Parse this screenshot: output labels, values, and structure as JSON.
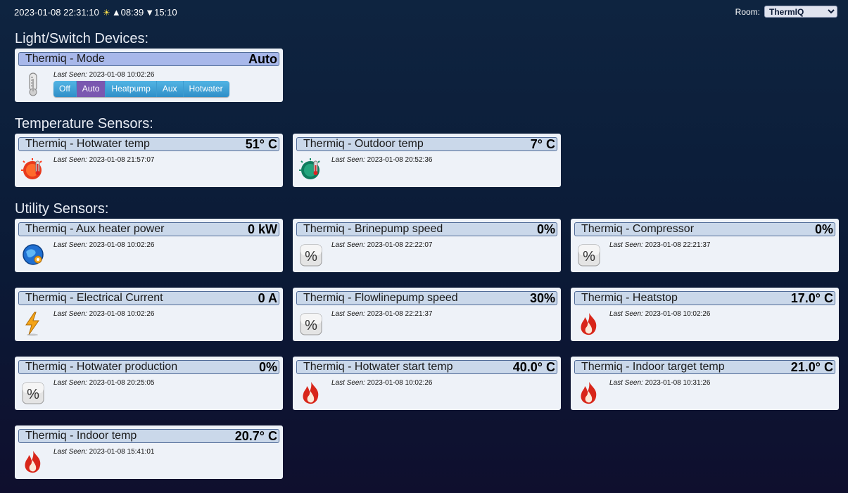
{
  "topbar": {
    "datetime": "2023-01-08 22:31:10",
    "sun_icon": "sun-icon",
    "sunrise": "▲08:39",
    "sunset": "▼15:10"
  },
  "room": {
    "label": "Room:",
    "selected": "ThermIQ"
  },
  "sections": {
    "light": "Light/Switch Devices:",
    "temp": "Temperature Sensors:",
    "utility": "Utility Sensors:"
  },
  "mode_card": {
    "name": "Thermiq - Mode",
    "value": "Auto",
    "seen_label": "Last Seen:",
    "seen": "2023-01-08 10:02:26",
    "icon": "thermometer-icon",
    "buttons": [
      "Off",
      "Auto",
      "Heatpump",
      "Aux",
      "Hotwater"
    ],
    "active": "Auto"
  },
  "temp_cards": [
    {
      "name": "Thermiq - Hotwater temp",
      "value": "51° C",
      "seen": "2023-01-08 21:57:07",
      "icon": "hot-temp-icon"
    },
    {
      "name": "Thermiq - Outdoor temp",
      "value": "7° C",
      "seen": "2023-01-08 20:52:36",
      "icon": "cold-temp-icon"
    }
  ],
  "util_cards": [
    {
      "name": "Thermiq - Aux heater power",
      "value": "0 kW",
      "seen": "2023-01-08 10:02:26",
      "icon": "globe-icon"
    },
    {
      "name": "Thermiq - Brinepump speed",
      "value": "0%",
      "seen": "2023-01-08 22:22:07",
      "icon": "percent-icon"
    },
    {
      "name": "Thermiq - Compressor",
      "value": "0%",
      "seen": "2023-01-08 22:21:37",
      "icon": "percent-icon"
    },
    {
      "name": "Thermiq - Electrical Current",
      "value": "0 A",
      "seen": "2023-01-08 10:02:26",
      "icon": "lightning-icon"
    },
    {
      "name": "Thermiq - Flowlinepump speed",
      "value": "30%",
      "seen": "2023-01-08 22:21:37",
      "icon": "percent-icon"
    },
    {
      "name": "Thermiq - Heatstop",
      "value": "17.0° C",
      "seen": "2023-01-08 10:02:26",
      "icon": "flame-icon"
    },
    {
      "name": "Thermiq - Hotwater production",
      "value": "0%",
      "seen": "2023-01-08 20:25:05",
      "icon": "percent-icon"
    },
    {
      "name": "Thermiq - Hotwater start temp",
      "value": "40.0° C",
      "seen": "2023-01-08 10:02:26",
      "icon": "flame-icon"
    },
    {
      "name": "Thermiq - Indoor target temp",
      "value": "21.0° C",
      "seen": "2023-01-08 10:31:26",
      "icon": "flame-icon"
    },
    {
      "name": "Thermiq - Indoor temp",
      "value": "20.7° C",
      "seen": "2023-01-08 15:41:01",
      "icon": "flame-icon"
    }
  ],
  "seen_label": "Last Seen:"
}
